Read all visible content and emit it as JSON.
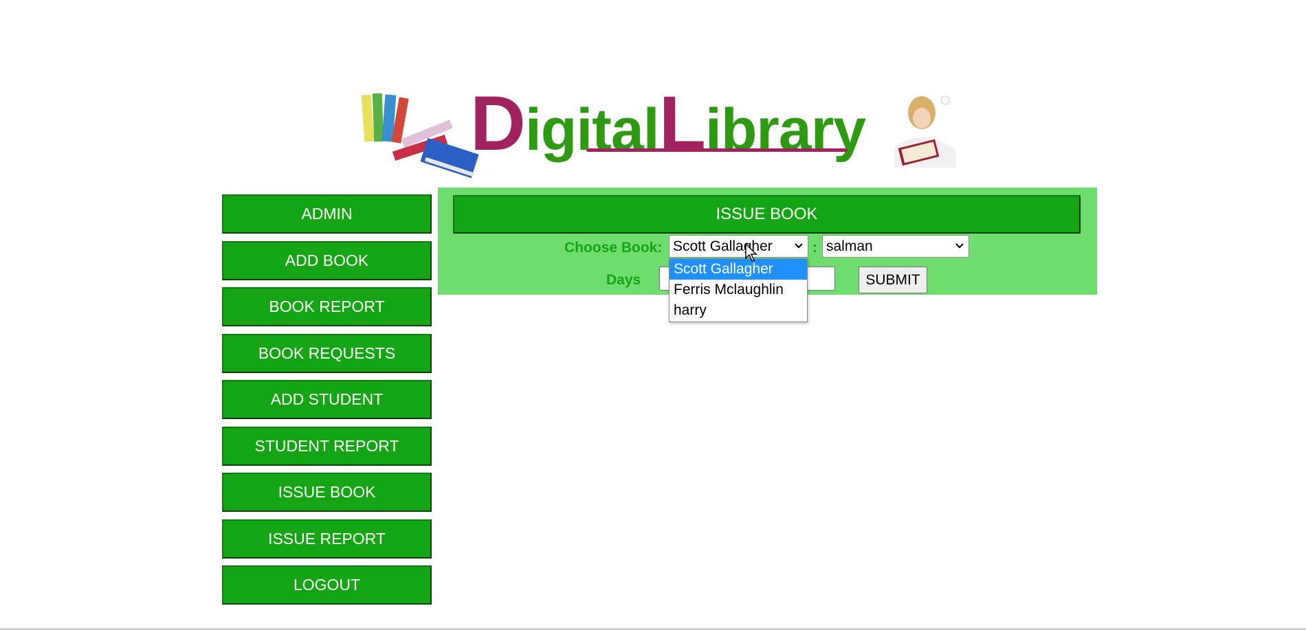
{
  "logo": {
    "word1_initial": "D",
    "word1_rest": "igital",
    "word2_initial": "L",
    "word2_rest": "ibrary"
  },
  "sidebar": {
    "items": [
      {
        "label": "ADMIN"
      },
      {
        "label": "ADD BOOK"
      },
      {
        "label": "BOOK REPORT"
      },
      {
        "label": "BOOK REQUESTS"
      },
      {
        "label": "ADD STUDENT"
      },
      {
        "label": "STUDENT REPORT"
      },
      {
        "label": "ISSUE BOOK"
      },
      {
        "label": "ISSUE REPORT"
      },
      {
        "label": "LOGOUT"
      }
    ]
  },
  "panel": {
    "title": "ISSUE BOOK",
    "choose_book_label": "Choose Book:",
    "separator": ":",
    "book_select_value": "Scott Gallagher",
    "student_select_value": "salman",
    "days_label": "Days",
    "days_value": "",
    "submit_label": "SUBMIT"
  },
  "book_dropdown": {
    "options": [
      "Scott Gallagher",
      "Ferris Mclaughlin",
      "harry"
    ],
    "selected_index": 0
  },
  "colors": {
    "nav_green": "#14a514",
    "panel_green": "#6ddd6d",
    "logo_magenta": "#a0235f",
    "logo_green": "#2e9a12",
    "highlight_blue": "#1e90ff"
  }
}
